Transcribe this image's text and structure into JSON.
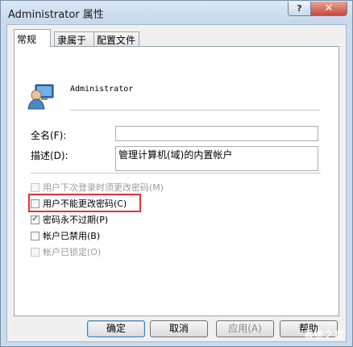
{
  "window": {
    "title": "Administrator 属性",
    "help_label": "?",
    "close_label": "✕"
  },
  "tabs": [
    {
      "label": "常规",
      "active": true
    },
    {
      "label": "隶属于",
      "active": false
    },
    {
      "label": "配置文件",
      "active": false
    }
  ],
  "user": {
    "icon": "user-account-icon",
    "name": "Administrator"
  },
  "fields": {
    "fullname_label": "全名(F):",
    "fullname_value": "",
    "description_label": "描述(D):",
    "description_value": "管理计算机(域)的内置帐户"
  },
  "options": [
    {
      "label": "用户下次登录时须更改密码(M)",
      "checked": false,
      "disabled": true
    },
    {
      "label": "用户不能更改密码(C)",
      "checked": false,
      "disabled": false
    },
    {
      "label": "密码永不过期(P)",
      "checked": true,
      "disabled": false
    },
    {
      "label": "帐户已禁用(B)",
      "checked": false,
      "disabled": false
    },
    {
      "label": "帐户已锁定(O)",
      "checked": false,
      "disabled": true
    }
  ],
  "buttons": {
    "ok": "确定",
    "cancel": "取消",
    "apply": "应用(A)",
    "help": "帮助"
  },
  "watermark": "系统之家"
}
